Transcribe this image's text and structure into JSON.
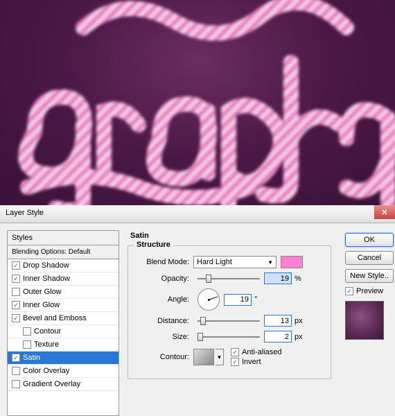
{
  "canvas_text_line": "graphy",
  "dialog": {
    "title": "Layer Style"
  },
  "styles_panel": {
    "header": "Styles",
    "blending": "Blending Options: Default",
    "items": [
      {
        "label": "Drop Shadow",
        "checked": true
      },
      {
        "label": "Inner Shadow",
        "checked": true
      },
      {
        "label": "Outer Glow",
        "checked": false
      },
      {
        "label": "Inner Glow",
        "checked": true
      },
      {
        "label": "Bevel and Emboss",
        "checked": true
      },
      {
        "label": "Contour",
        "checked": false,
        "indent": true
      },
      {
        "label": "Texture",
        "checked": false,
        "indent": true
      },
      {
        "label": "Satin",
        "checked": true,
        "selected": true
      },
      {
        "label": "Color Overlay",
        "checked": false
      },
      {
        "label": "Gradient Overlay",
        "checked": false
      }
    ]
  },
  "settings": {
    "title": "Satin",
    "structure_label": "Structure",
    "blend_mode": {
      "label": "Blend Mode:",
      "value": "Hard Light",
      "color": "#ff7fd0"
    },
    "opacity": {
      "label": "Opacity:",
      "value": "19",
      "unit": "%"
    },
    "angle": {
      "label": "Angle:",
      "value": "19",
      "unit": "°"
    },
    "distance": {
      "label": "Distance:",
      "value": "13",
      "unit": "px"
    },
    "size": {
      "label": "Size:",
      "value": "2",
      "unit": "px"
    },
    "contour": {
      "label": "Contour:",
      "antialiased_label": "Anti-aliased",
      "antialiased": true,
      "invert_label": "Invert",
      "invert": true
    }
  },
  "buttons": {
    "ok": "OK",
    "cancel": "Cancel",
    "new_style": "New Style..",
    "preview_label": "Preview"
  },
  "preview_checked": true
}
